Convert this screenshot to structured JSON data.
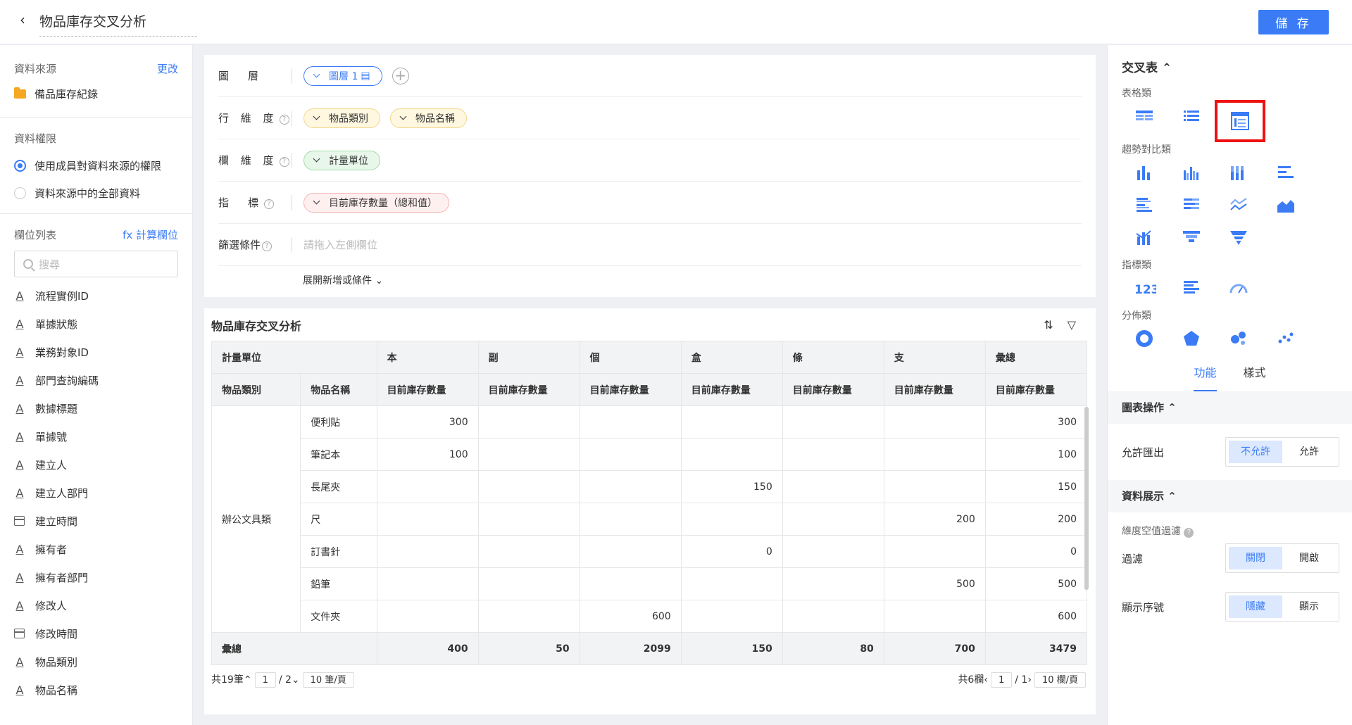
{
  "header": {
    "title": "物品庫存交叉分析",
    "save": "儲 存"
  },
  "left": {
    "source_label": "資料來源",
    "source_change": "更改",
    "source_name": "備品庫存紀錄",
    "perm_label": "資料權限",
    "perm_opt1": "使用成員對資料來源的權限",
    "perm_opt2": "資料來源中的全部資料",
    "fields_label": "欄位列表",
    "calc_field": "fx 計算欄位",
    "search_placeholder": "搜尋",
    "fields": [
      "流程實例ID",
      "單據狀態",
      "業務對象ID",
      "部門查詢編碼",
      "數據標題",
      "單據號",
      "建立人",
      "建立人部門",
      "建立時間",
      "擁有者",
      "擁有者部門",
      "修改人",
      "修改時間",
      "物品類別",
      "物品名稱"
    ]
  },
  "config": {
    "layer_label": "圖　層",
    "layer_value": "圖層 1",
    "row_label": "行 維 度",
    "row_dims": [
      "物品類別",
      "物品名稱"
    ],
    "col_label": "欄 維 度",
    "col_dims": [
      "計量單位"
    ],
    "metric_label": "指　標",
    "metric": "目前庫存數量（總和值）",
    "filter_label": "篩選條件",
    "filter_placeholder": "請拖入左側欄位",
    "expand": "展開新增或條件"
  },
  "table": {
    "title": "物品庫存交叉分析",
    "unit_header": "計量單位",
    "units": [
      "本",
      "副",
      "個",
      "盒",
      "條",
      "支",
      "彙總"
    ],
    "cat_header": "物品類別",
    "name_header": "物品名稱",
    "metric_header": "目前庫存數量",
    "category": "辦公文具類",
    "rows": [
      {
        "name": "便利貼",
        "v": [
          "300",
          "",
          "",
          "",
          "",
          "",
          "300"
        ]
      },
      {
        "name": "筆記本",
        "v": [
          "100",
          "",
          "",
          "",
          "",
          "",
          "100"
        ]
      },
      {
        "name": "長尾夾",
        "v": [
          "",
          "",
          "",
          "150",
          "",
          "",
          "150"
        ]
      },
      {
        "name": "尺",
        "v": [
          "",
          "",
          "",
          "",
          "",
          "200",
          "200"
        ]
      },
      {
        "name": "訂書針",
        "v": [
          "",
          "",
          "",
          "0",
          "",
          "",
          "0"
        ]
      },
      {
        "name": "鉛筆",
        "v": [
          "",
          "",
          "",
          "",
          "",
          "500",
          "500"
        ]
      },
      {
        "name": "文件夾",
        "v": [
          "",
          "",
          "600",
          "",
          "",
          "",
          "600"
        ]
      }
    ],
    "total_label": "彙總",
    "totals": [
      "400",
      "50",
      "2099",
      "150",
      "80",
      "700",
      "3479"
    ],
    "pager_left": {
      "total": "共19筆",
      "page": "1",
      "of": "/ 2",
      "size": "10 筆/頁"
    },
    "pager_right": {
      "total": "共6欄",
      "page": "1",
      "of": "/ 1",
      "size": "10 欄/頁"
    }
  },
  "right": {
    "title": "交叉表",
    "cat1": "表格類",
    "cat2": "趨勢對比類",
    "cat3": "指標類",
    "cat4": "分佈類",
    "tab_func": "功能",
    "tab_style": "樣式",
    "sec1": "圖表操作",
    "allow_export": "允許匯出",
    "export_opts": [
      "不允許",
      "允許"
    ],
    "sec2": "資料展示",
    "null_filter": "維度空值過濾",
    "filter": "過濾",
    "filter_opts": [
      "關閉",
      "開啟"
    ],
    "seq": "顯示序號",
    "seq_opts": [
      "隱藏",
      "顯示"
    ]
  }
}
